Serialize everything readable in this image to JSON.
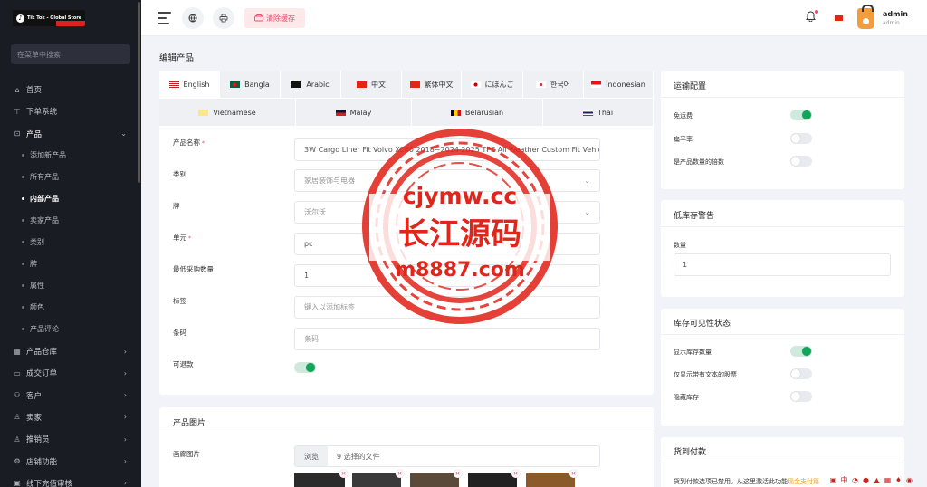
{
  "sidebar": {
    "brand": "Tik Tok - Global Store",
    "search_placeholder": "在菜单中搜索",
    "items": [
      {
        "label": "首页",
        "icon": "home-icon",
        "type": "item"
      },
      {
        "label": "下单系统",
        "icon": "pos-icon",
        "type": "item"
      },
      {
        "label": "产品",
        "icon": "cart-icon",
        "type": "open"
      },
      {
        "label": "添加新产品",
        "type": "sub"
      },
      {
        "label": "所有产品",
        "type": "sub"
      },
      {
        "label": "内部产品",
        "type": "sub",
        "active": true
      },
      {
        "label": "卖家产品",
        "type": "sub"
      },
      {
        "label": "类别",
        "type": "sub"
      },
      {
        "label": "牌",
        "type": "sub"
      },
      {
        "label": "属性",
        "type": "sub"
      },
      {
        "label": "颜色",
        "type": "sub"
      },
      {
        "label": "产品评论",
        "type": "sub"
      },
      {
        "label": "产品仓库",
        "icon": "warehouse-icon",
        "type": "item"
      },
      {
        "label": "成交订单",
        "icon": "orders-icon",
        "type": "item"
      },
      {
        "label": "客户",
        "icon": "customers-icon",
        "type": "item"
      },
      {
        "label": "卖家",
        "icon": "seller-icon",
        "type": "item"
      },
      {
        "label": "推销员",
        "icon": "salesman-icon",
        "type": "item"
      },
      {
        "label": "店铺功能",
        "icon": "store-icon",
        "type": "item"
      },
      {
        "label": "线下充值审核",
        "icon": "recharge-icon",
        "type": "item"
      }
    ]
  },
  "header": {
    "clear_cache": "清除缓存",
    "user_name": "admin",
    "user_role": "admin"
  },
  "page": {
    "title": "编辑产品"
  },
  "languages": {
    "row1": [
      "English",
      "Bangla",
      "Arabic",
      "中文",
      "繁体中文",
      "にほんご",
      "한국어",
      "Indonesian"
    ],
    "row2": [
      "Vietnamese",
      "Malay",
      "Belarusian",
      "Thai"
    ],
    "active": "English"
  },
  "form": {
    "name_label": "产品名称",
    "name_value": "3W Cargo Liner Fit Volvo XC60 2018~2024 2025 TPE All Weather Custom Fit Vehicle",
    "category_label": "类别",
    "category_value": "家居装饰与电器",
    "brand_label": "牌",
    "brand_value": "沃尔沃",
    "unit_label": "单元",
    "unit_value": "pc",
    "min_qty_label": "最低采购数量",
    "min_qty_value": "1",
    "tags_label": "标签",
    "tags_placeholder": "键入以添加标签",
    "barcode_label": "条码",
    "barcode_placeholder": "条码",
    "refundable_label": "可退款",
    "required_mark": "*"
  },
  "images": {
    "title": "产品图片",
    "gallery_label": "画廊图片",
    "browse": "浏览",
    "selected": "9 选择的文件",
    "thumb_count": 5
  },
  "shipping": {
    "title": "运输配置",
    "free_shipping": "免运费",
    "flat_rate": "扁平率",
    "qty_multiply": "是产品数量的倍数",
    "free_shipping_on": true,
    "flat_rate_on": false,
    "qty_multiply_on": false
  },
  "low_stock": {
    "title": "低库存警告",
    "qty_label": "数量",
    "qty_value": "1"
  },
  "stock_visibility": {
    "title": "库存可见性状态",
    "show_qty": "显示库存数量",
    "text_only": "仅显示带有文本的股票",
    "hide": "隐藏库存",
    "show_qty_on": true,
    "text_only_on": false,
    "hide_on": false
  },
  "cod": {
    "title": "货到付款",
    "note": "货到付款选项已禁用。从这里激活此功能",
    "link": "现金支付篇"
  },
  "watermark": {
    "line1": "cjymw.cc",
    "line2": "长江源码",
    "line3": "m8887.com"
  },
  "colors": {
    "sidebar_bg": "#1a1c24",
    "accent_green": "#0fa65a",
    "danger": "#ef486a",
    "watermark_red": "#e0251b"
  }
}
